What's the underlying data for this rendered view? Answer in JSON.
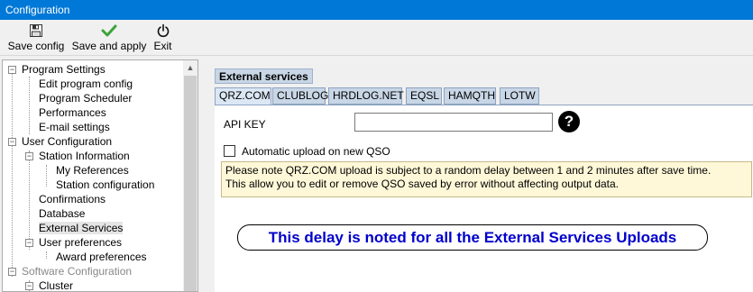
{
  "window": {
    "title": "Configuration"
  },
  "toolbar": {
    "save_config": "Save config",
    "save_and_apply": "Save and apply",
    "exit": "Exit"
  },
  "tree": {
    "items": [
      {
        "label": "Program Settings"
      },
      {
        "label": "Edit program config"
      },
      {
        "label": "Program Scheduler"
      },
      {
        "label": "Performances"
      },
      {
        "label": "E-mail settings"
      },
      {
        "label": "User Configuration"
      },
      {
        "label": "Station Information"
      },
      {
        "label": "My References"
      },
      {
        "label": "Station configuration"
      },
      {
        "label": "Confirmations"
      },
      {
        "label": "Database"
      },
      {
        "label": "External Services"
      },
      {
        "label": "User preferences"
      },
      {
        "label": "Award preferences"
      },
      {
        "label": "Software Configuration"
      },
      {
        "label": "Cluster"
      }
    ]
  },
  "panel": {
    "title": "External services",
    "tabs": [
      {
        "label": "QRZ.COM"
      },
      {
        "label": "CLUBLOG"
      },
      {
        "label": "HRDLOG.NET"
      },
      {
        "label": "EQSL"
      },
      {
        "label": "HAMQTH"
      },
      {
        "label": "LOTW"
      }
    ],
    "api_key_label": "API KEY",
    "api_key_value": "",
    "help_glyph": "?",
    "auto_upload_label": "Automatic upload on new QSO",
    "note_line1": "Please note QRZ.COM upload is subject to a random delay between 1 and 2 minutes after save time.",
    "note_line2": "This allow you to edit or remove QSO saved by error without affecting output data.",
    "banner": "This delay is noted for all the External Services Uploads"
  }
}
